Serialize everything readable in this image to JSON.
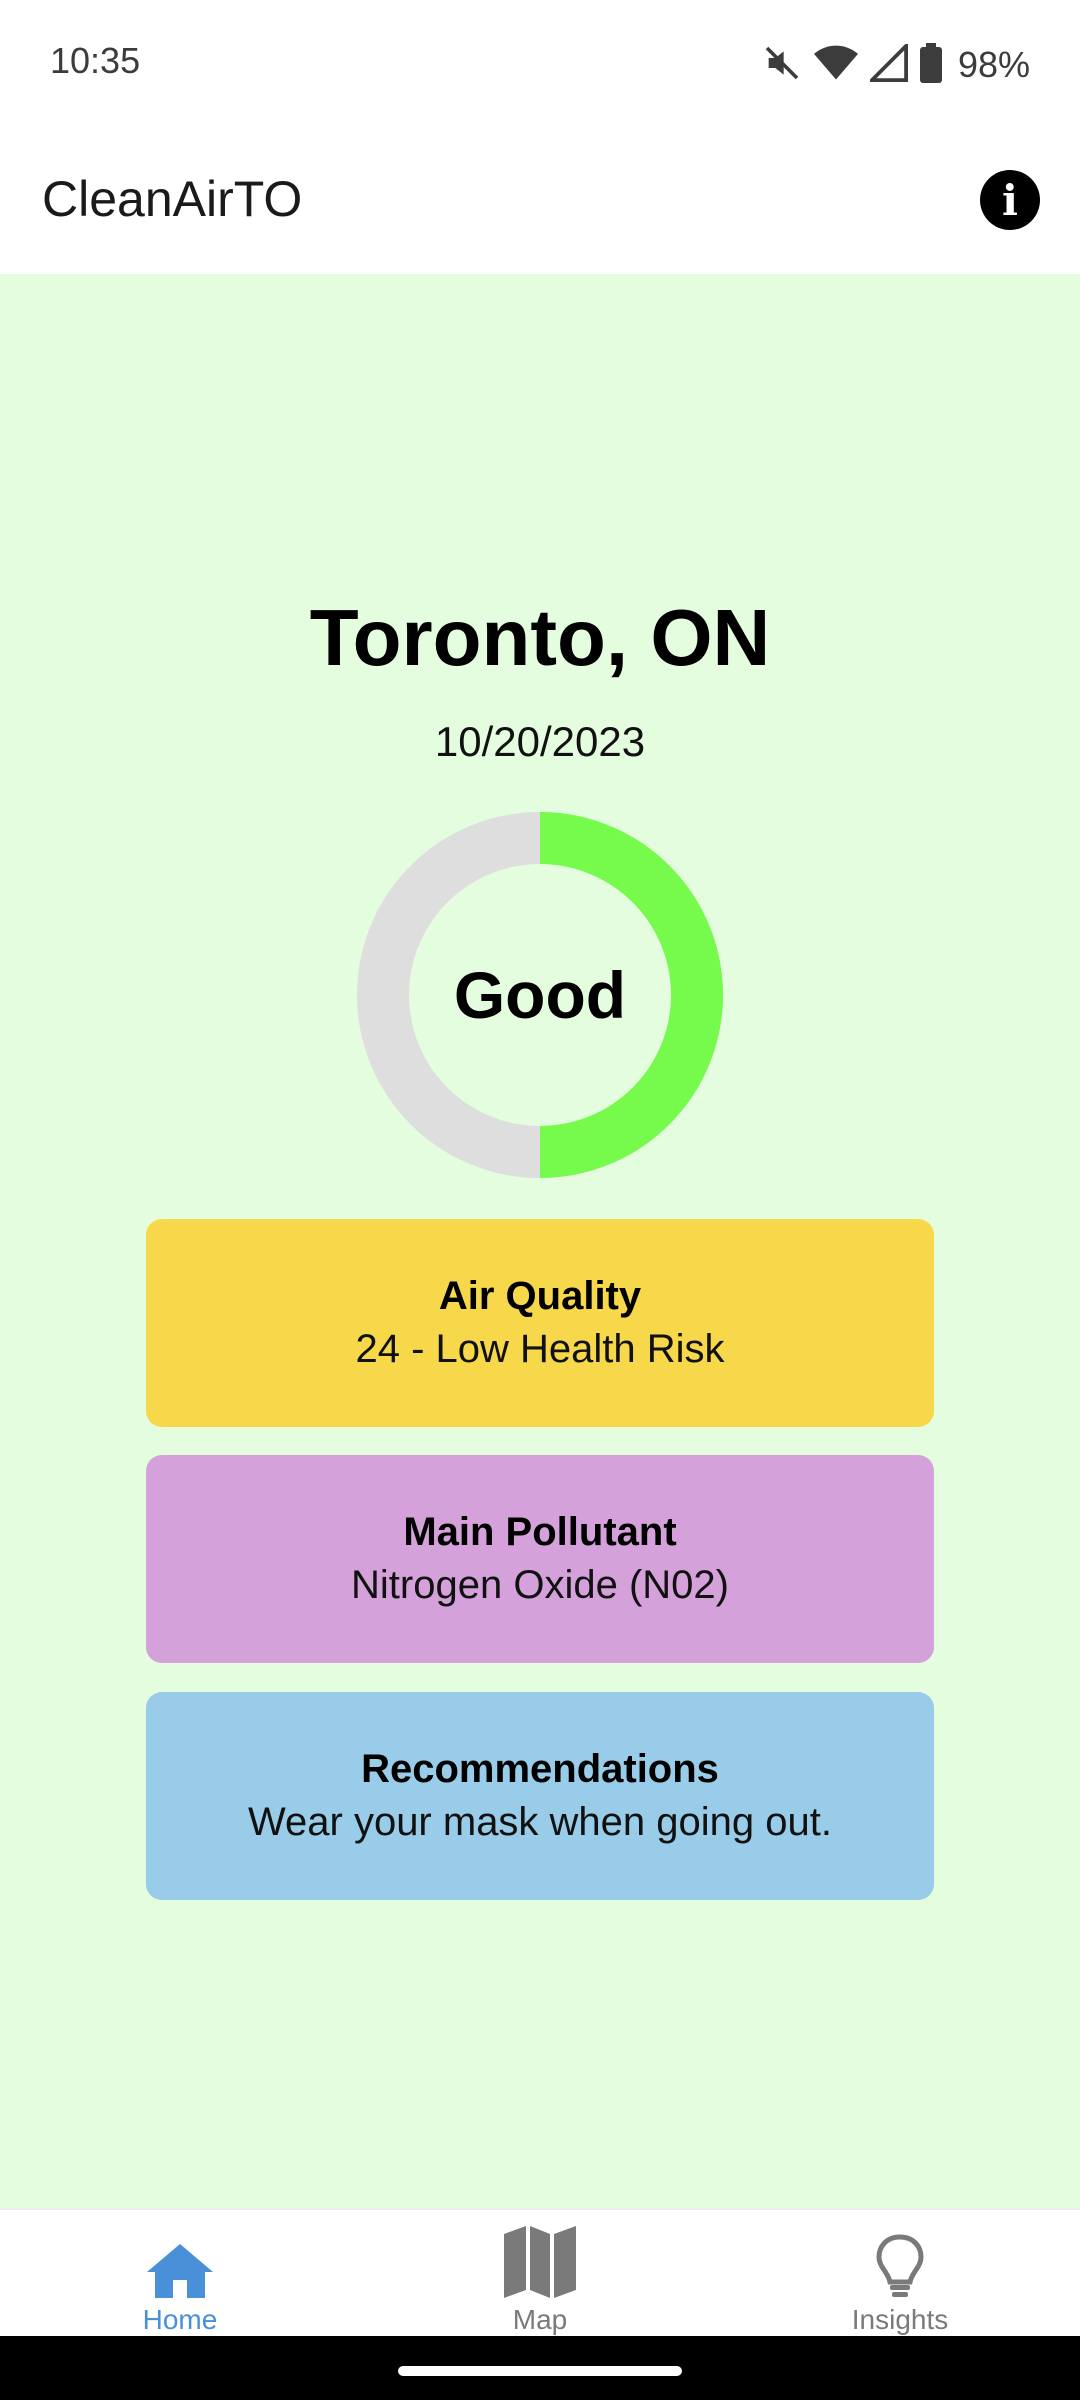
{
  "status_bar": {
    "time": "10:35",
    "battery": "98%",
    "icons": [
      "mute-icon",
      "wifi-icon",
      "signal-icon",
      "battery-icon"
    ]
  },
  "app_bar": {
    "title": "CleanAirTO",
    "info_icon": "info-icon"
  },
  "location": {
    "city": "Toronto, ON",
    "date": "10/20/2023"
  },
  "gauge": {
    "label": "Good",
    "fill_fraction": 0.5,
    "fill_color": "#76fb4c",
    "track_color": "#dedede"
  },
  "cards": {
    "air_quality": {
      "title": "Air Quality",
      "value": "24 - Low Health Risk",
      "color": "#f7d84b"
    },
    "pollutant": {
      "title": "Main Pollutant",
      "value": "Nitrogen Oxide (N02)",
      "color": "#d4a1da"
    },
    "recommendations": {
      "title": "Recommendations",
      "value": "Wear your mask when going out.",
      "color": "#98cce8"
    }
  },
  "nav": {
    "items": [
      {
        "label": "Home",
        "icon": "home-icon",
        "active": true
      },
      {
        "label": "Map",
        "icon": "map-icon",
        "active": false
      },
      {
        "label": "Insights",
        "icon": "lightbulb-icon",
        "active": false
      }
    ],
    "active_color": "#4a90d9",
    "inactive_color": "#7a7a7a"
  },
  "colors": {
    "background": "#e4fddf"
  }
}
